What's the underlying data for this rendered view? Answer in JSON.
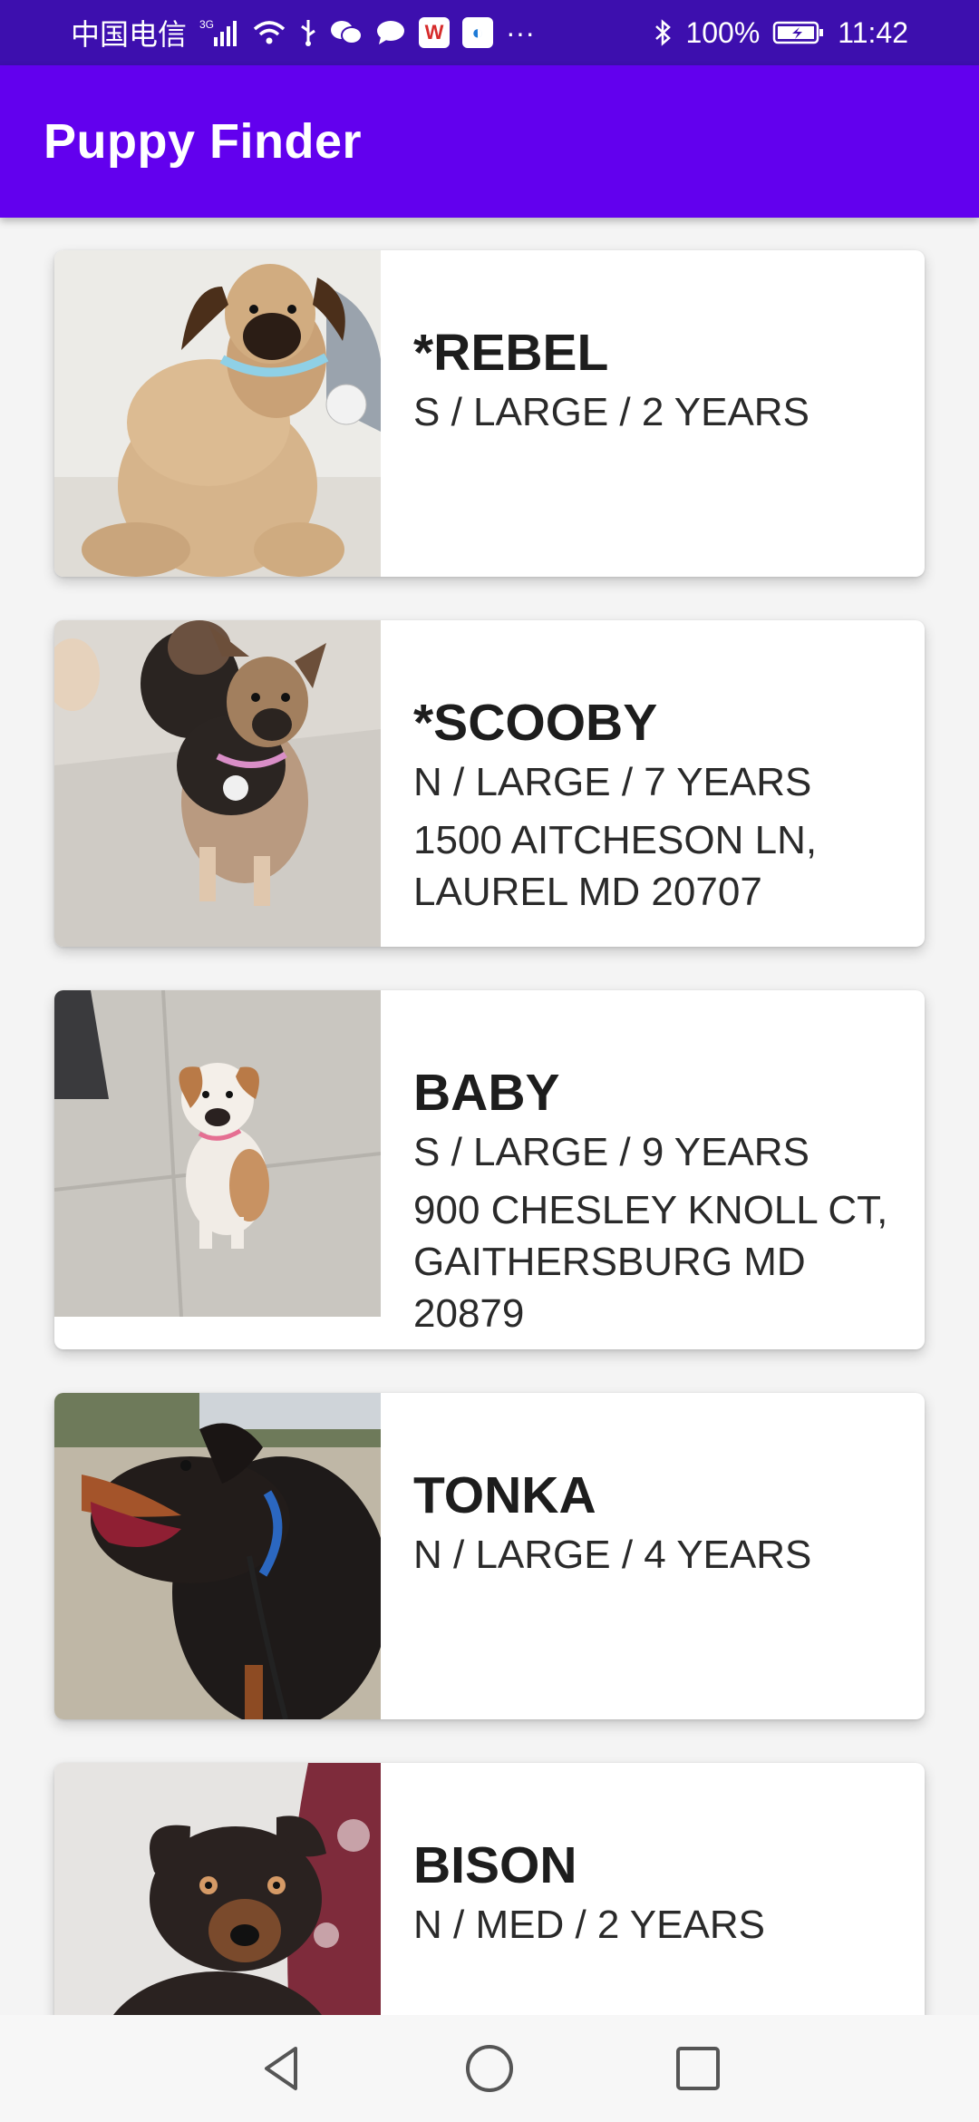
{
  "status_bar": {
    "carrier": "中国电信",
    "network": "3G",
    "battery": "100%",
    "time": "11:42",
    "icons": [
      "signal-icon",
      "wifi-icon",
      "usb-icon",
      "wechat-icon",
      "message-icon",
      "wps-icon",
      "browser-icon",
      "more-icon",
      "bluetooth-icon",
      "battery-icon"
    ]
  },
  "app_bar": {
    "title": "Puppy Finder"
  },
  "puppies": [
    {
      "name": "*REBEL",
      "meta": "S / LARGE / 2 YEARS",
      "address": ""
    },
    {
      "name": "*SCOOBY",
      "meta": "N / LARGE / 7 YEARS",
      "address": "1500 AITCHESON LN, LAUREL MD 20707"
    },
    {
      "name": "BABY",
      "meta": "S / LARGE / 9 YEARS",
      "address": "900 CHESLEY KNOLL CT, GAITHERSBURG MD 20879"
    },
    {
      "name": "TONKA",
      "meta": "N / LARGE / 4 YEARS",
      "address": ""
    },
    {
      "name": "BISON",
      "meta": "N / MED / 2 YEARS",
      "address": ""
    }
  ],
  "nav_bar": {
    "icons": [
      "back-icon",
      "home-icon",
      "recents-icon"
    ]
  },
  "colors": {
    "status_bar": "#3d0fae",
    "app_bar": "#6200ee"
  }
}
